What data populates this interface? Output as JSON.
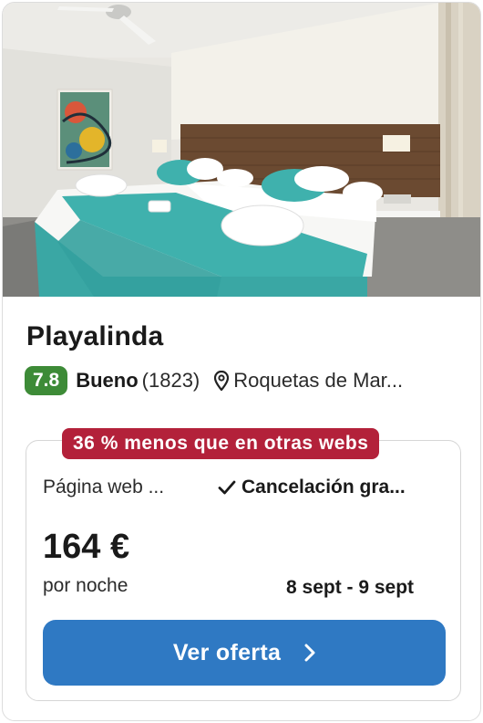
{
  "hotel": {
    "name": "Playalinda",
    "image_alt": "Habitación con camas blancas y mantas turquesa",
    "rating": {
      "score": "7.8",
      "verdict": "Bueno",
      "reviews": "(1823)",
      "score_color": "#3d8b37"
    },
    "location": "Roquetas de Mar..."
  },
  "offer": {
    "savings_badge": "36 % menos que en otras webs",
    "savings_color": "#b3213a",
    "provider": "Página web ...",
    "cancellation": "Cancelación gra...",
    "price": "164 €",
    "price_unit": "por noche",
    "dates": "8 sept - 9 sept",
    "cta_label": "Ver oferta",
    "cta_color": "#2f79c3"
  },
  "icons": {
    "location": "map-pin-icon",
    "cancellation": "check-icon",
    "cta": "chevron-right-icon"
  }
}
